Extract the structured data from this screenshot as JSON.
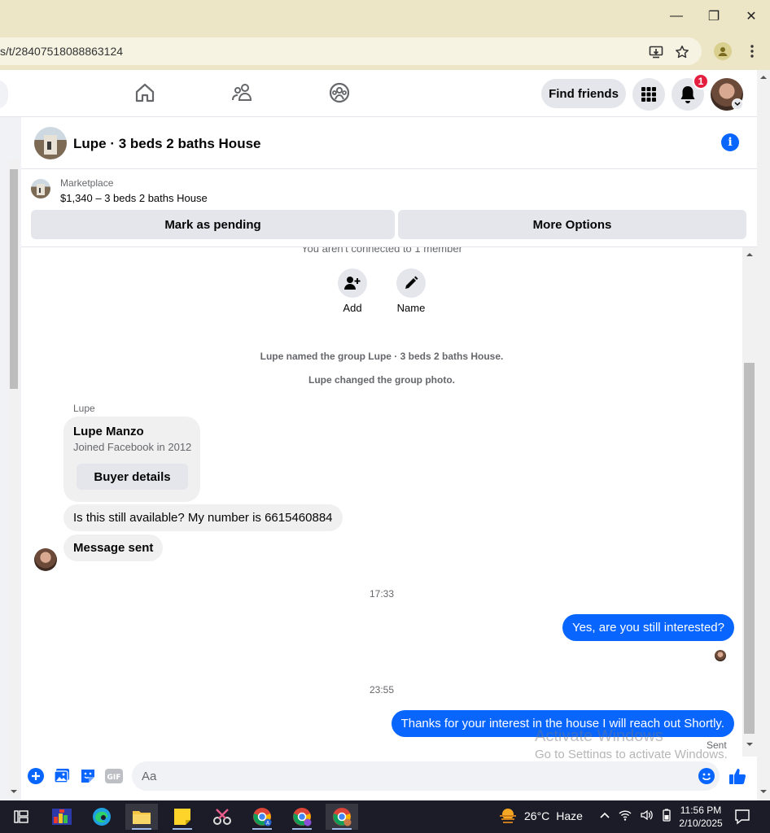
{
  "browser": {
    "url": "s/t/28407518088863124",
    "window_controls": {
      "minimize": "—",
      "restore": "❐",
      "close": "✕"
    }
  },
  "header": {
    "find_friends_label": "Find friends",
    "notification_count": "1"
  },
  "conversation": {
    "title": "Lupe · 3 beds 2 baths House"
  },
  "marketplace": {
    "label": "Marketplace",
    "listing": "$1,340 – 3 beds 2 baths House",
    "mark_pending_label": "Mark as pending",
    "more_options_label": "More Options"
  },
  "chat": {
    "connection_note": "You aren't connected to 1 member",
    "add_label": "Add",
    "name_label": "Name",
    "system_messages": [
      "Lupe named the group Lupe · 3 beds 2 baths House.",
      "Lupe changed the group photo."
    ],
    "sender_name": "Lupe",
    "buyer_card": {
      "name": "Lupe Manzo",
      "subtitle": "Joined Facebook in 2012",
      "button_label": "Buyer details"
    },
    "incoming": [
      "Is this still available? My number is 6615460884",
      "Message sent"
    ],
    "timestamp_1": "17:33",
    "outgoing_1": "Yes, are you still interested?",
    "timestamp_2": "23:55",
    "outgoing_2": "Thanks for your interest in the house I will reach out Shortly.",
    "sent_status": "Sent"
  },
  "watermark": {
    "line1": "Activate Windows",
    "line2": "Go to Settings to activate Windows."
  },
  "composer": {
    "placeholder": "Aa"
  },
  "taskbar": {
    "temperature": "26°C",
    "weather_text": "Haze",
    "time": "11:56 PM",
    "date": "2/10/2025"
  },
  "colors": {
    "messenger_blue": "#0866ff",
    "badge_red": "#e41e3f",
    "chrome_frame": "#ece6c6"
  }
}
